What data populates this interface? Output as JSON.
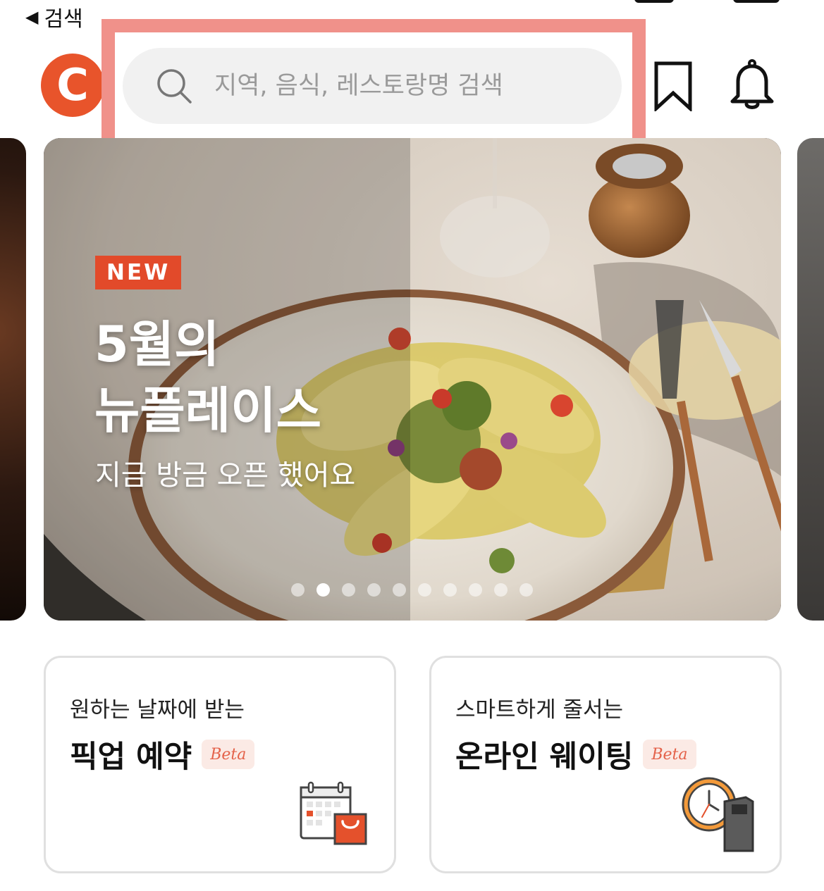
{
  "nav": {
    "back_label": "검색"
  },
  "header": {
    "logo_letter": "C",
    "search_placeholder": "지역, 음식, 레스토랑명 검색"
  },
  "banner": {
    "badge": "NEW",
    "title_line1": "5월의",
    "title_line2": "뉴플레이스",
    "subtitle": "지금 방금 오픈 했어요",
    "page_count": 10,
    "active_page": 2
  },
  "cards": [
    {
      "subtitle": "원하는 날짜에 받는",
      "title": "픽업 예약",
      "badge": "Beta",
      "icon": "calendar-shopping-bag-icon"
    },
    {
      "subtitle": "스마트하게 줄서는",
      "title": "온라인 웨이팅",
      "badge": "Beta",
      "icon": "clock-kiosk-icon"
    }
  ],
  "colors": {
    "brand": "#e8542b",
    "highlight": "#f0918a",
    "search_bg": "#f1f1f1",
    "beta_bg": "#fbeae5",
    "beta_text": "#e4624a"
  }
}
